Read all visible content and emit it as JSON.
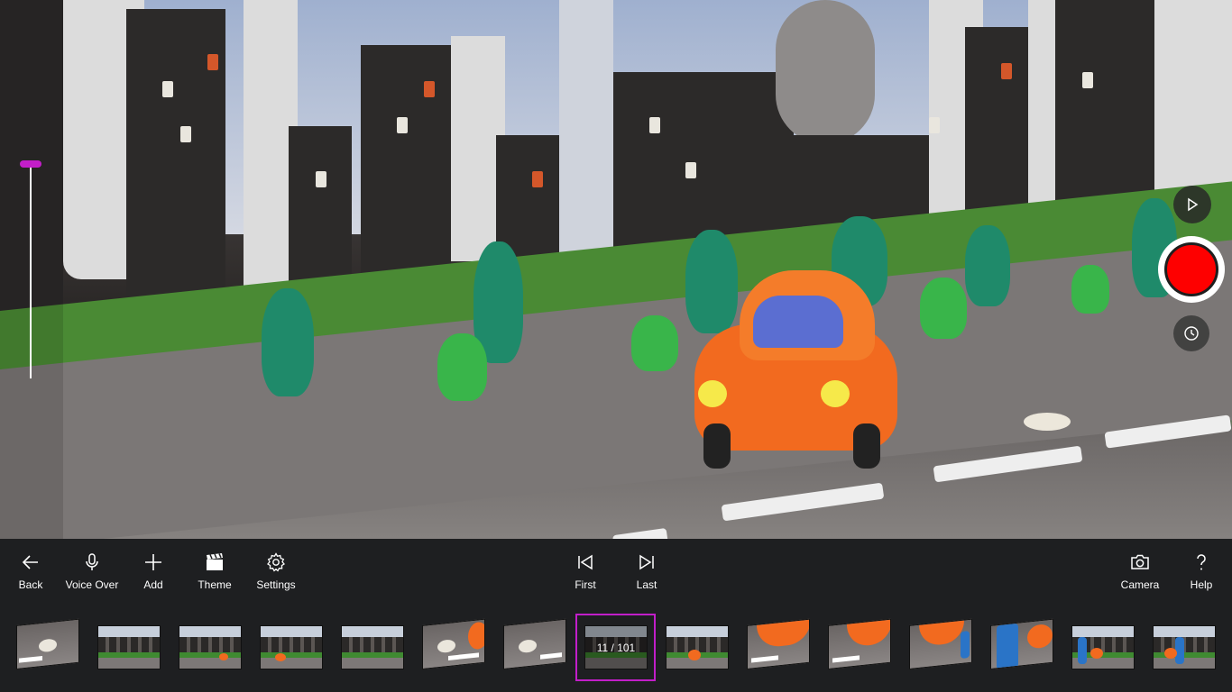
{
  "toolbar": {
    "back": "Back",
    "voice_over": "Voice Over",
    "add": "Add",
    "theme": "Theme",
    "settings": "Settings",
    "first": "First",
    "last": "Last",
    "camera": "Camera",
    "help": "Help"
  },
  "filmstrip": {
    "counter": "11 / 101",
    "current_frame": 11,
    "total_frames": 101
  },
  "colors": {
    "accent": "#c21ec9",
    "record": "#fe0000",
    "toolbar_bg": "#1e1f21"
  },
  "icons": {
    "back": "arrow-left-icon",
    "voice_over": "microphone-icon",
    "add": "plus-icon",
    "theme": "clapperboard-icon",
    "settings": "gear-icon",
    "first": "skip-first-icon",
    "last": "skip-last-icon",
    "camera": "camera-icon",
    "help": "question-icon",
    "play": "play-icon",
    "record": "record-icon",
    "timer": "clock-icon"
  }
}
